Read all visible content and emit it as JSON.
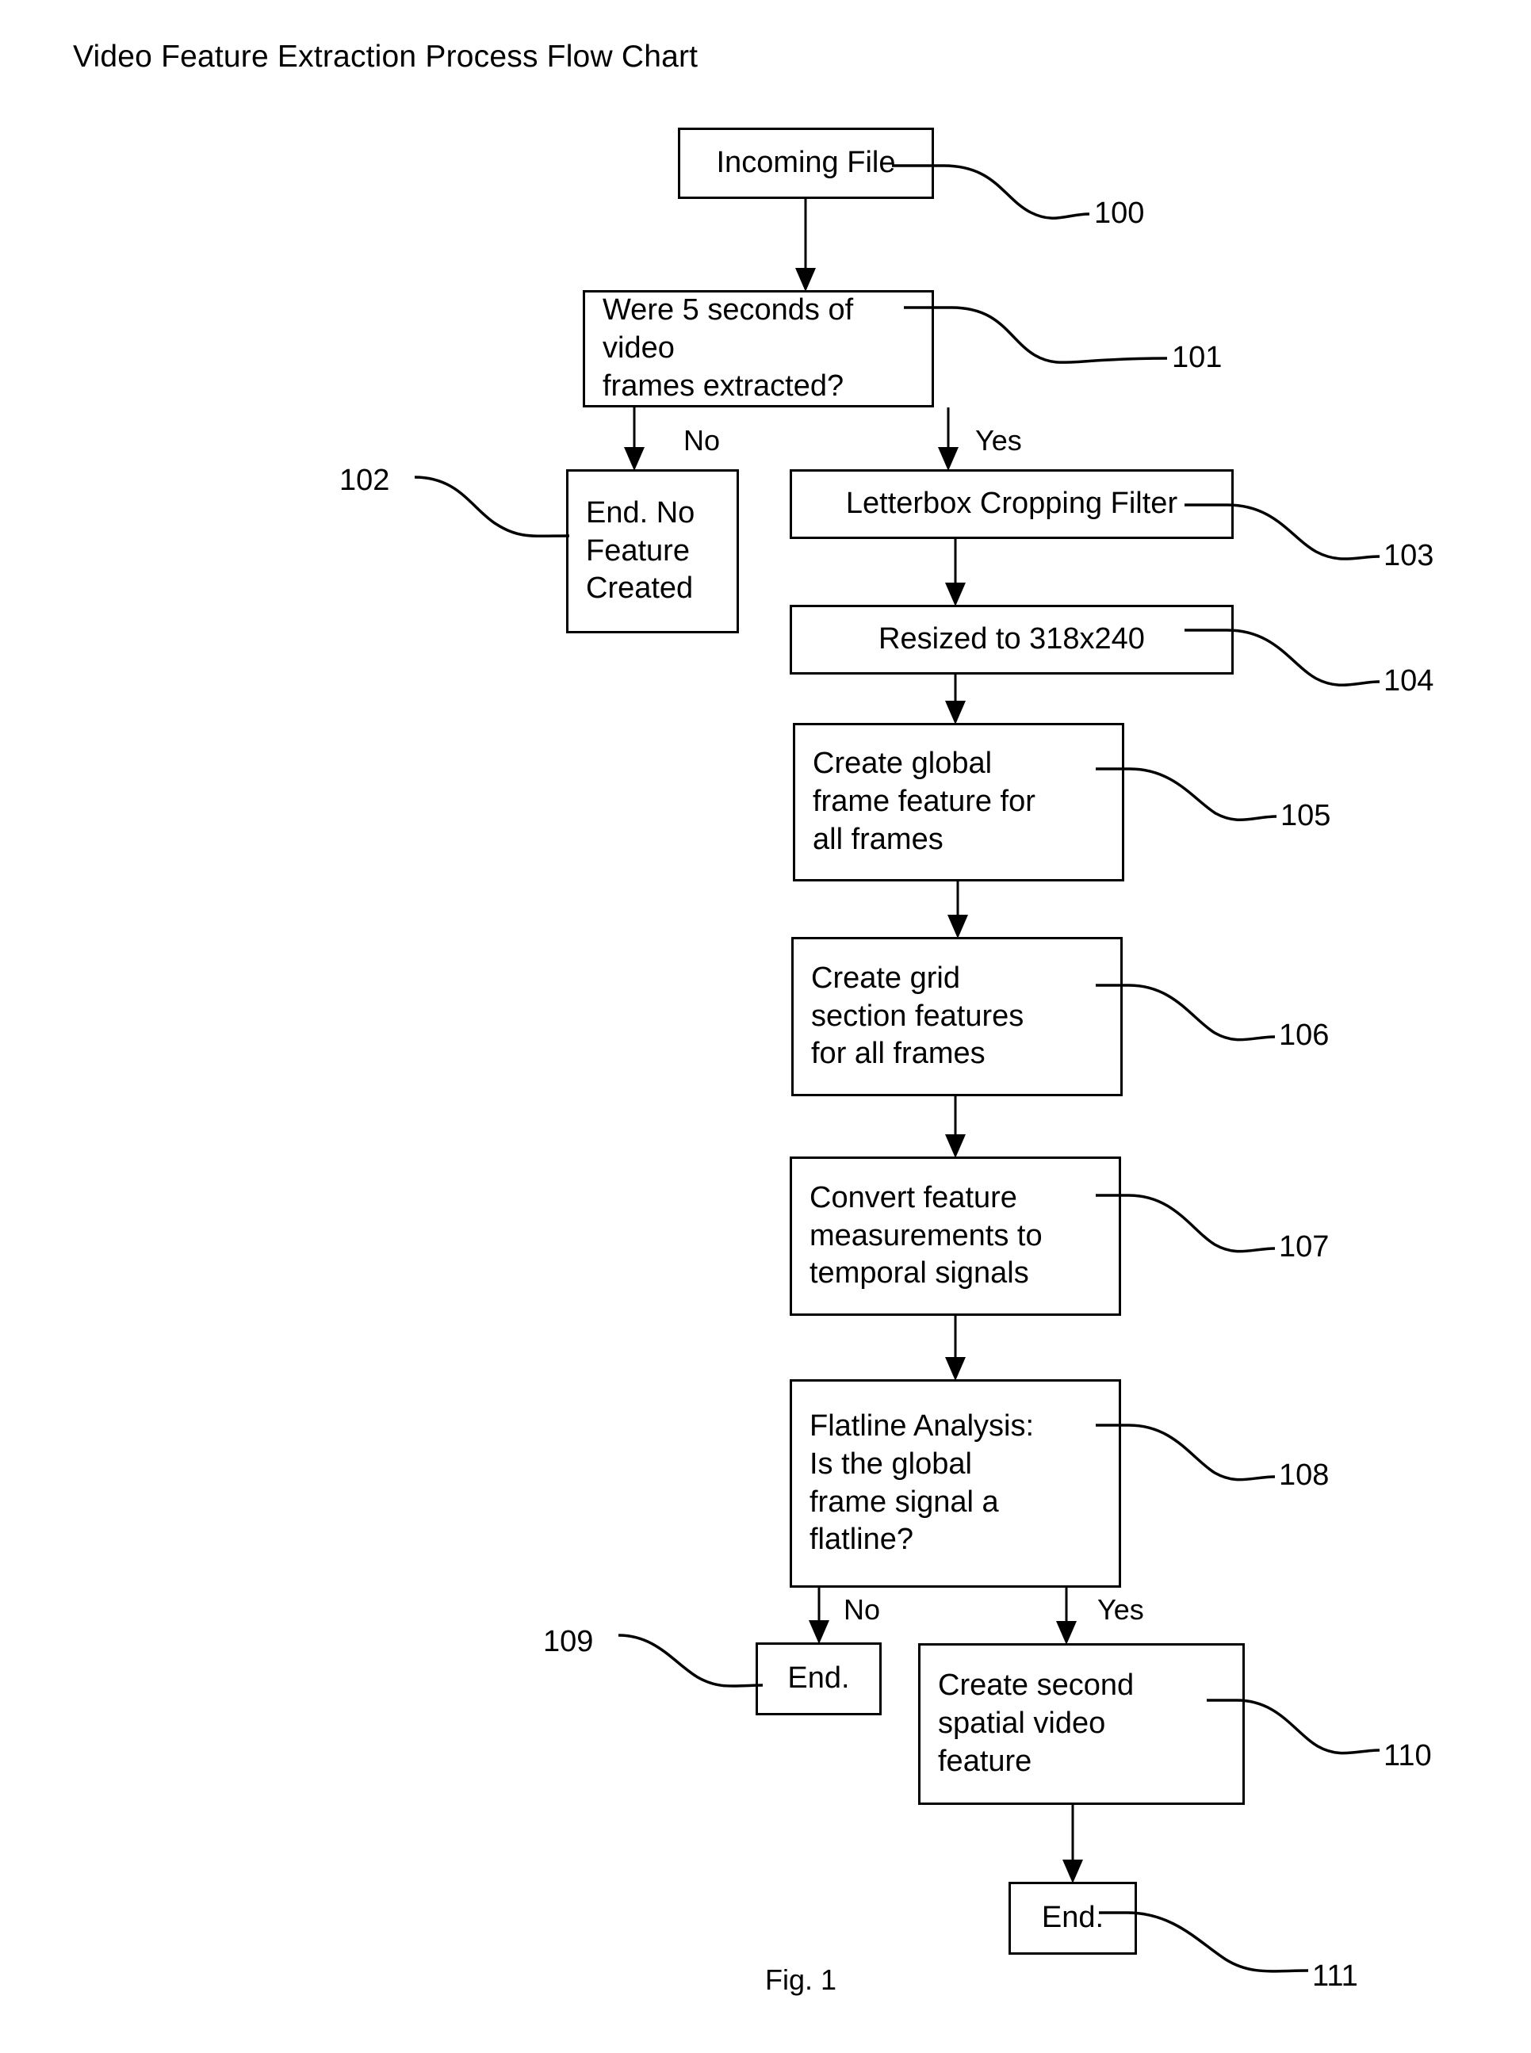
{
  "title": "Video Feature Extraction Process Flow Chart",
  "figure_caption": "Fig. 1",
  "colors": {
    "ink": "#000000",
    "paper": "#ffffff"
  },
  "nodes": [
    {
      "id": "n100",
      "ref": "100",
      "text": "Incoming File",
      "shape": "process"
    },
    {
      "id": "n101",
      "ref": "101",
      "text": "Were 5 seconds of video\nframes extracted?",
      "shape": "decision"
    },
    {
      "id": "n102",
      "ref": "102",
      "text": "End. No\nFeature\nCreated",
      "shape": "terminal"
    },
    {
      "id": "n103",
      "ref": "103",
      "text": "Letterbox Cropping Filter",
      "shape": "process"
    },
    {
      "id": "n104",
      "ref": "104",
      "text": "Resized to 318x240",
      "shape": "process"
    },
    {
      "id": "n105",
      "ref": "105",
      "text": "Create global\nframe feature for\nall frames",
      "shape": "process"
    },
    {
      "id": "n106",
      "ref": "106",
      "text": "Create grid\nsection features\nfor all frames",
      "shape": "process"
    },
    {
      "id": "n107",
      "ref": "107",
      "text": "Convert feature\nmeasurements to\ntemporal signals",
      "shape": "process"
    },
    {
      "id": "n108",
      "ref": "108",
      "text": "Flatline Analysis:\nIs the global\nframe signal a\nflatline?",
      "shape": "decision"
    },
    {
      "id": "n109",
      "ref": "109",
      "text": "End.",
      "shape": "terminal"
    },
    {
      "id": "n110",
      "ref": "110",
      "text": "Create second\nspatial video\nfeature",
      "shape": "process"
    },
    {
      "id": "n111",
      "ref": "111",
      "text": "End.",
      "shape": "terminal"
    }
  ],
  "edge_labels": [
    {
      "id": "e101-no",
      "text": "No"
    },
    {
      "id": "e101-yes",
      "text": "Yes"
    },
    {
      "id": "e108-no",
      "text": "No"
    },
    {
      "id": "e108-yes",
      "text": "Yes"
    }
  ]
}
